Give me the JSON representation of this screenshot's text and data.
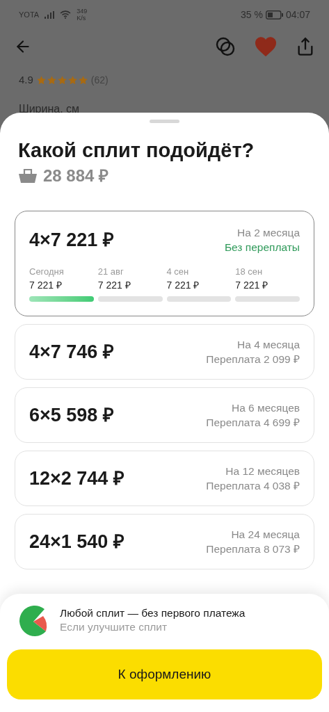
{
  "status_bar": {
    "carrier": "YOTA",
    "speed_value": "349",
    "speed_unit": "K/s",
    "battery_percent": "35 %",
    "time": "04:07"
  },
  "header": {
    "favorite": true
  },
  "rating": {
    "value": "4.9",
    "stars": 5,
    "count": "(62)"
  },
  "section_label": "Ширина, см",
  "sheet": {
    "title": "Какой сплит подойдёт?",
    "total": "28 884 ₽",
    "plans": [
      {
        "amount": "4×7 221 ₽",
        "term": "На 2 месяца",
        "note": "Без переплаты",
        "kind": "free",
        "selected": true,
        "schedule": [
          {
            "date": "Сегодня",
            "amount": "7 221 ₽",
            "paid": true
          },
          {
            "date": "21 авг",
            "amount": "7 221 ₽",
            "paid": false
          },
          {
            "date": "4 сен",
            "amount": "7 221 ₽",
            "paid": false
          },
          {
            "date": "18 сен",
            "amount": "7 221 ₽",
            "paid": false
          }
        ]
      },
      {
        "amount": "4×7 746 ₽",
        "term": "На 4 месяца",
        "note": "Переплата 2 099 ₽",
        "kind": "overpay",
        "selected": false
      },
      {
        "amount": "6×5 598 ₽",
        "term": "На 6 месяцев",
        "note": "Переплата 4 699 ₽",
        "kind": "overpay",
        "selected": false
      },
      {
        "amount": "12×2 744 ₽",
        "term": "На 12 месяцев",
        "note": "Переплата 4 038 ₽",
        "kind": "overpay",
        "selected": false
      },
      {
        "amount": "24×1 540 ₽",
        "term": "На 24 месяца",
        "note": "Переплата 8 073 ₽",
        "kind": "overpay",
        "selected": false
      }
    ]
  },
  "promo": {
    "title": "Любой сплит — без первого платежа",
    "subtitle": "Если улучшите сплит"
  },
  "checkout_button": "К оформлению"
}
